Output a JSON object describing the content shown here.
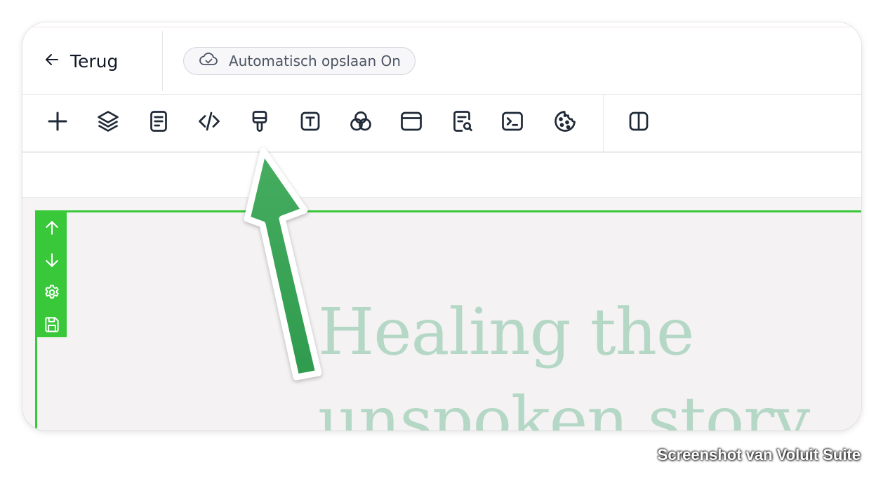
{
  "header": {
    "back_label": "Terug",
    "autosave_label": "Automatisch opslaan On"
  },
  "toolbar": {
    "tools": [
      {
        "icon": "plus-icon"
      },
      {
        "icon": "layers-icon"
      },
      {
        "icon": "document-icon"
      },
      {
        "icon": "code-icon"
      },
      {
        "icon": "paint-brush-icon"
      },
      {
        "icon": "text-icon"
      },
      {
        "icon": "color-circles-icon"
      },
      {
        "icon": "browser-window-icon"
      },
      {
        "icon": "page-search-icon"
      },
      {
        "icon": "terminal-icon"
      },
      {
        "icon": "cookie-icon"
      },
      {
        "icon": "split-view-icon"
      }
    ]
  },
  "section_tools": [
    {
      "icon": "arrow-up-icon"
    },
    {
      "icon": "arrow-down-icon"
    },
    {
      "icon": "gear-icon"
    },
    {
      "icon": "save-icon"
    }
  ],
  "canvas": {
    "hero_line_1": "Healing the",
    "hero_line_2": "unspoken story"
  },
  "watermark": "Screenshot van Voluit Suite",
  "colors": {
    "accent_green": "#38c83a",
    "annotation_arrow": "#3aa35a",
    "hero_text": "#b5d8c6",
    "text_dark": "#111827"
  }
}
